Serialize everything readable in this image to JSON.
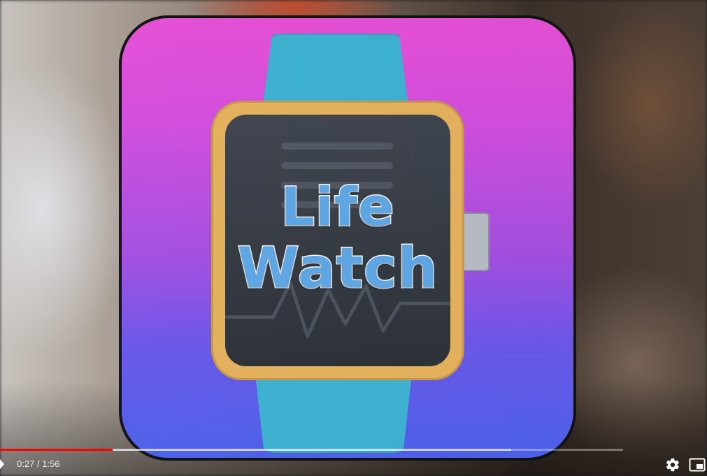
{
  "video": {
    "logo": {
      "line1": "Life",
      "line2": "Watch"
    }
  },
  "controls": {
    "current_time": "0:27",
    "separator": "/",
    "duration": "1:56",
    "progress_fraction": 0.181,
    "buffered_fraction": 0.82,
    "icons": {
      "play": "play-icon",
      "settings": "gear-icon",
      "miniplayer": "miniplayer-icon"
    },
    "colors": {
      "played": "#ff0000",
      "icon": "#ffffff"
    }
  }
}
